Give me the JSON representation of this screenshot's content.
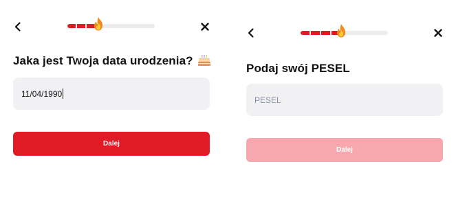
{
  "colors": {
    "accent": "#e11b26",
    "accent_disabled": "#f6a8ae",
    "input_bg": "#f1f1f4",
    "track": "#ebebeb"
  },
  "left_screen": {
    "back_icon": "chevron-left-icon",
    "close_icon": "close-icon",
    "progress_fraction": 0.33,
    "progress_icon": "flame-icon",
    "question": "Jaka jest Twoja data urodzenia?",
    "question_icon": "birthday-cake-icon",
    "date_input": {
      "value": "11/04/1990"
    },
    "next_button": {
      "label": "Dalej",
      "enabled": true
    }
  },
  "right_screen": {
    "back_icon": "chevron-left-icon",
    "close_icon": "close-icon",
    "progress_fraction": 0.46,
    "progress_icon": "flame-icon",
    "question": "Podaj swój PESEL",
    "pesel_input": {
      "placeholder": "PESEL",
      "value": ""
    },
    "next_button": {
      "label": "Dalej",
      "enabled": false
    }
  }
}
